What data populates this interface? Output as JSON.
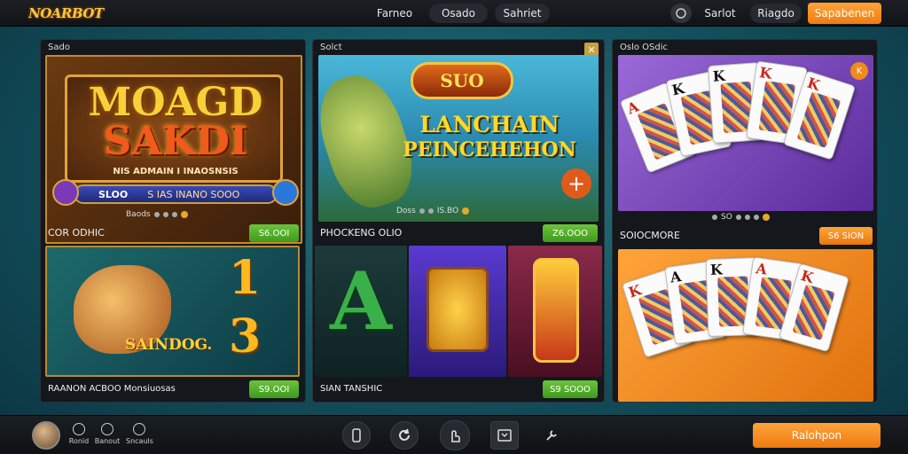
{
  "topbar": {
    "logo": "NOARBOT",
    "nav": [
      "Farneo",
      "Osado",
      "Sahriet"
    ],
    "right_nav": [
      "Sarlot",
      "Riagdo"
    ],
    "cta": "Sapabenen"
  },
  "panels": [
    {
      "title": "Sado",
      "hero": {
        "headline1": "MOAGD",
        "headline2": "SAKDI",
        "tagline": "NIS ADMAIN I INAOSNSIS",
        "bar_left": "SLOO",
        "bar_right": "S IAS INANO SOOO"
      },
      "dots_label": "Baods",
      "game1": {
        "name": "COR ODHIC",
        "price": "S6.OOI"
      },
      "tile2_text": "SAINDOG.",
      "tile2_digits": [
        "1",
        "3"
      ],
      "game2": {
        "name": "RAANON ACBOO Monsiuosas",
        "price": "S9.OOI"
      }
    },
    {
      "title": "Solct",
      "hero": {
        "badge": "SUO",
        "headline1": "LANCHAIN",
        "headline2": "PEINCEHEHON"
      },
      "dots_label": "Doss",
      "dots_value": "IS.BO",
      "game1": {
        "name": "PHOCKENG OLIO",
        "price": "Z6.OOO"
      },
      "game2": {
        "name": "SIAN TANSHIC",
        "price": "S9 SOOO"
      }
    },
    {
      "title": "Oslo OSdic",
      "dots_label": "SO",
      "game1": {
        "name": "SOIOCMORE",
        "price": "S6 SION"
      }
    }
  ],
  "bottombar": {
    "items": [
      "Ronid",
      "Banout",
      "Sncauls"
    ],
    "cta": "Ralohpon"
  },
  "colors": {
    "accent_orange": "#f08a1c",
    "price_green": "#4fae27",
    "panel_bg": "#14171b"
  }
}
